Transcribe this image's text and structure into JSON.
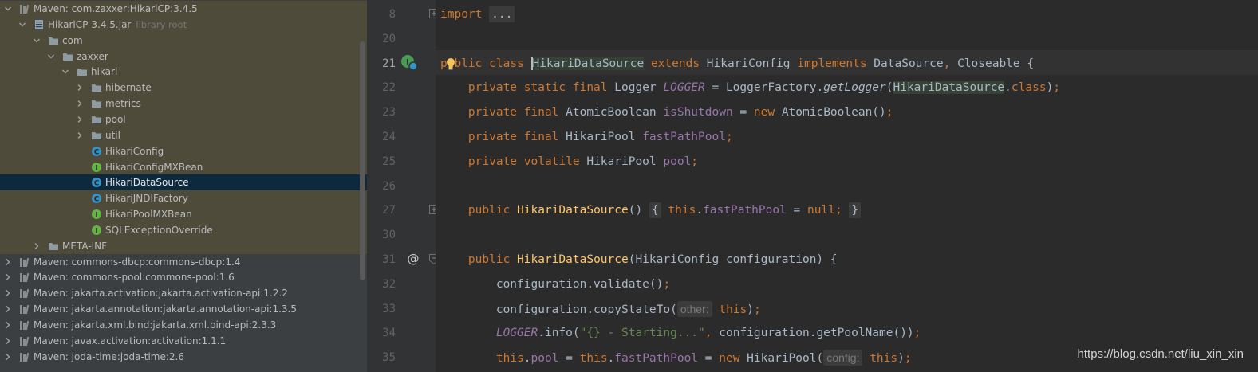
{
  "project_tree": {
    "rows": [
      {
        "label": "Maven: com.zaxxer:HikariCP:3.4.5",
        "sub": "",
        "icon": "library-icon",
        "arrow": "down"
      },
      {
        "label": "HikariCP-3.4.5.jar",
        "sub": "library root",
        "icon": "jar-icon",
        "arrow": "down"
      },
      {
        "label": "com",
        "sub": "",
        "icon": "package-icon",
        "arrow": "down"
      },
      {
        "label": "zaxxer",
        "sub": "",
        "icon": "package-icon",
        "arrow": "down"
      },
      {
        "label": "hikari",
        "sub": "",
        "icon": "package-icon",
        "arrow": "down"
      },
      {
        "label": "hibernate",
        "sub": "",
        "icon": "package-icon",
        "arrow": "right"
      },
      {
        "label": "metrics",
        "sub": "",
        "icon": "package-icon",
        "arrow": "right"
      },
      {
        "label": "pool",
        "sub": "",
        "icon": "package-icon",
        "arrow": "right"
      },
      {
        "label": "util",
        "sub": "",
        "icon": "package-icon",
        "arrow": "right"
      },
      {
        "label": "HikariConfig",
        "sub": "",
        "icon": "class-icon",
        "arrow": ""
      },
      {
        "label": "HikariConfigMXBean",
        "sub": "",
        "icon": "interface-icon",
        "arrow": ""
      },
      {
        "label": "HikariDataSource",
        "sub": "",
        "icon": "class-icon",
        "arrow": ""
      },
      {
        "label": "HikariJNDIFactory",
        "sub": "",
        "icon": "class-icon",
        "arrow": ""
      },
      {
        "label": "HikariPoolMXBean",
        "sub": "",
        "icon": "interface-icon",
        "arrow": ""
      },
      {
        "label": "SQLExceptionOverride",
        "sub": "",
        "icon": "interface-icon",
        "arrow": ""
      },
      {
        "label": "META-INF",
        "sub": "",
        "icon": "package-icon",
        "arrow": "right"
      },
      {
        "label": "Maven: commons-dbcp:commons-dbcp:1.4",
        "sub": "",
        "icon": "library-icon",
        "arrow": "right"
      },
      {
        "label": "Maven: commons-pool:commons-pool:1.6",
        "sub": "",
        "icon": "library-icon",
        "arrow": "right"
      },
      {
        "label": "Maven: jakarta.activation:jakarta.activation-api:1.2.2",
        "sub": "",
        "icon": "library-icon",
        "arrow": "right"
      },
      {
        "label": "Maven: jakarta.annotation:jakarta.annotation-api:1.3.5",
        "sub": "",
        "icon": "library-icon",
        "arrow": "right"
      },
      {
        "label": "Maven: jakarta.xml.bind:jakarta.xml.bind-api:2.3.3",
        "sub": "",
        "icon": "library-icon",
        "arrow": "right"
      },
      {
        "label": "Maven: javax.activation:activation:1.1.1",
        "sub": "",
        "icon": "library-icon",
        "arrow": "right"
      },
      {
        "label": "Maven: joda-time:joda-time:2.6",
        "sub": "",
        "icon": "library-icon",
        "arrow": "right"
      }
    ],
    "selected_label": "HikariDataSource"
  },
  "editor": {
    "line_numbers": [
      "8",
      "20",
      "21",
      "22",
      "23",
      "24",
      "25",
      "26",
      "27",
      "30",
      "31",
      "32",
      "33",
      "34",
      "35"
    ],
    "lines": [
      [
        {
          "t": "import",
          "c": "kw"
        },
        {
          "t": " ",
          "c": ""
        },
        {
          "t": "...",
          "c": "fold"
        }
      ],
      [],
      [
        {
          "t": "public",
          "c": "kw"
        },
        {
          "t": " ",
          "c": ""
        },
        {
          "t": "class",
          "c": "kw"
        },
        {
          "t": " ",
          "c": ""
        },
        {
          "t": "HikariDataSource",
          "c": "hl caret"
        },
        {
          "t": " ",
          "c": ""
        },
        {
          "t": "extends",
          "c": "kw"
        },
        {
          "t": " HikariConfig ",
          "c": ""
        },
        {
          "t": "implements",
          "c": "kw"
        },
        {
          "t": " DataSource",
          "c": ""
        },
        {
          "t": ",",
          "c": "kw"
        },
        {
          "t": " Closeable {",
          "c": ""
        }
      ],
      [
        {
          "t": "    ",
          "c": ""
        },
        {
          "t": "private static final",
          "c": "kw"
        },
        {
          "t": " Logger ",
          "c": ""
        },
        {
          "t": "LOGGER",
          "c": "st"
        },
        {
          "t": " = LoggerFactory.",
          "c": ""
        },
        {
          "t": "getLogger",
          "c": "it"
        },
        {
          "t": "(",
          "c": ""
        },
        {
          "t": "HikariDataSource",
          "c": "hl"
        },
        {
          "t": ".",
          "c": ""
        },
        {
          "t": "class",
          "c": "kw"
        },
        {
          "t": ")",
          "c": ""
        },
        {
          "t": ";",
          "c": "kw"
        }
      ],
      [
        {
          "t": "    ",
          "c": ""
        },
        {
          "t": "private final",
          "c": "kw"
        },
        {
          "t": " AtomicBoolean ",
          "c": ""
        },
        {
          "t": "isShutdown",
          "c": "fld"
        },
        {
          "t": " = ",
          "c": ""
        },
        {
          "t": "new",
          "c": "kw"
        },
        {
          "t": " AtomicBoolean()",
          "c": ""
        },
        {
          "t": ";",
          "c": "kw"
        }
      ],
      [
        {
          "t": "    ",
          "c": ""
        },
        {
          "t": "private final",
          "c": "kw"
        },
        {
          "t": " HikariPool ",
          "c": ""
        },
        {
          "t": "fastPathPool",
          "c": "fld"
        },
        {
          "t": ";",
          "c": "kw"
        }
      ],
      [
        {
          "t": "    ",
          "c": ""
        },
        {
          "t": "private volatile",
          "c": "kw"
        },
        {
          "t": " HikariPool ",
          "c": ""
        },
        {
          "t": "pool",
          "c": "fld"
        },
        {
          "t": ";",
          "c": "kw"
        }
      ],
      [],
      [
        {
          "t": "    ",
          "c": ""
        },
        {
          "t": "public",
          "c": "kw"
        },
        {
          "t": " ",
          "c": ""
        },
        {
          "t": "HikariDataSource",
          "c": "fn"
        },
        {
          "t": "() ",
          "c": ""
        },
        {
          "t": "{",
          "c": "fold"
        },
        {
          "t": " ",
          "c": ""
        },
        {
          "t": "this",
          "c": "kw"
        },
        {
          "t": ".",
          "c": ""
        },
        {
          "t": "fastPathPool",
          "c": "fld"
        },
        {
          "t": " = ",
          "c": ""
        },
        {
          "t": "null",
          "c": "kw"
        },
        {
          "t": ";",
          "c": "kw"
        },
        {
          "t": " ",
          "c": ""
        },
        {
          "t": "}",
          "c": "fold"
        }
      ],
      [],
      [
        {
          "t": "    ",
          "c": ""
        },
        {
          "t": "public",
          "c": "kw"
        },
        {
          "t": " ",
          "c": ""
        },
        {
          "t": "HikariDataSource",
          "c": "fn"
        },
        {
          "t": "(HikariConfig configuration) {",
          "c": ""
        }
      ],
      [
        {
          "t": "        configuration.validate()",
          "c": ""
        },
        {
          "t": ";",
          "c": "kw"
        }
      ],
      [
        {
          "t": "        configuration.copyStateTo(",
          "c": ""
        },
        {
          "t": "other:",
          "c": "hint"
        },
        {
          "t": " ",
          "c": ""
        },
        {
          "t": "this",
          "c": "kw"
        },
        {
          "t": ")",
          "c": ""
        },
        {
          "t": ";",
          "c": "kw"
        }
      ],
      [
        {
          "t": "        ",
          "c": ""
        },
        {
          "t": "LOGGER",
          "c": "st"
        },
        {
          "t": ".info(",
          "c": ""
        },
        {
          "t": "\"{} - Starting...\"",
          "c": "str"
        },
        {
          "t": ", ",
          "c": "kw"
        },
        {
          "t": "configuration.getPoolName())",
          "c": ""
        },
        {
          "t": ";",
          "c": "kw"
        }
      ],
      [
        {
          "t": "        ",
          "c": ""
        },
        {
          "t": "this",
          "c": "kw"
        },
        {
          "t": ".",
          "c": ""
        },
        {
          "t": "pool",
          "c": "fld"
        },
        {
          "t": " = ",
          "c": ""
        },
        {
          "t": "this",
          "c": "kw"
        },
        {
          "t": ".",
          "c": ""
        },
        {
          "t": "fastPathPool",
          "c": "fld"
        },
        {
          "t": " = ",
          "c": ""
        },
        {
          "t": "new",
          "c": "kw"
        },
        {
          "t": " HikariPool(",
          "c": ""
        },
        {
          "t": "config:",
          "c": "hint"
        },
        {
          "t": " ",
          "c": ""
        },
        {
          "t": "this",
          "c": "kw"
        },
        {
          "t": ")",
          "c": ""
        },
        {
          "t": ";",
          "c": "kw"
        }
      ]
    ]
  },
  "watermark": "https://blog.csdn.net/liu_xin_xin",
  "colors": {
    "keyword": "#cc7832",
    "method_decl": "#ffc66d",
    "field": "#9876aa",
    "string": "#6a8759",
    "text": "#a9b7c6",
    "selected_row": "#0d293e",
    "highlight_row": "#4e4b3a"
  }
}
